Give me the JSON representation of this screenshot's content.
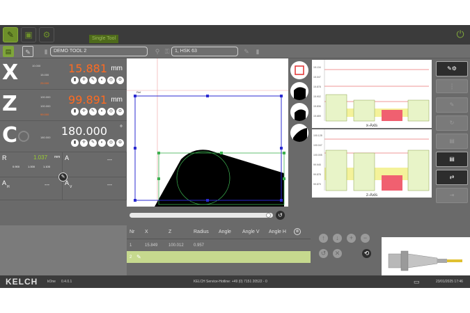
{
  "topbar": {
    "tooltip": "Single Tool"
  },
  "toolrow": {
    "tool_name": "DEMO TOOL 2",
    "holder": "1, HSK 63"
  },
  "axes": [
    {
      "letter": "X",
      "value": "15.881",
      "unit": "mm",
      "color": "#ff6a20",
      "mini": [
        "10.000",
        "15.000",
        "25.000"
      ]
    },
    {
      "letter": "Z",
      "value": "99.891",
      "unit": "mm",
      "color": "#ff6a20",
      "mini": [
        "100.000",
        "100.000",
        "99.000"
      ]
    },
    {
      "letter": "C",
      "value": "180.000",
      "unit": "°",
      "color": "#ffffff",
      "mini": [
        "",
        "180.000",
        ""
      ]
    }
  ],
  "cells": {
    "r_label": "R",
    "r_value": "1.037",
    "r_unit": "mm",
    "r_small": [
      "0.900",
      "1.000",
      "1.100"
    ],
    "a_label": "A",
    "a_value": "---",
    "ah_label": "A",
    "ah_sub": "H",
    "ah_value": "---",
    "av_label": "A",
    "av_sub": "V",
    "av_value": "---"
  },
  "canvas": {
    "corner_label": "Ref"
  },
  "charts": {
    "x_title": "x-Axis",
    "z_title": "z-Axis",
    "x_ticks": [
      "15.134",
      "15.047",
      "15.878",
      "15.902",
      "15.836",
      "15.689"
    ],
    "z_ticks": [
      "100.128",
      "100.047",
      "100.005",
      "99.945",
      "99.878",
      "99.879"
    ]
  },
  "right_buttons": [
    "",
    "",
    "",
    "",
    "",
    "",
    "",
    ""
  ],
  "table": {
    "headers": [
      "Nr",
      "X",
      "Z",
      "Radius",
      "Angle",
      "Angle V",
      "Angle H"
    ],
    "rows": [
      {
        "nr": "1",
        "x": "15.849",
        "z": "100.012",
        "r": "0.957"
      },
      {
        "nr": "2",
        "x": "",
        "z": "",
        "r": ""
      }
    ]
  },
  "footer": {
    "logo": "KELCH",
    "app": "kOne",
    "version": "0.4.0.1",
    "hotline": "KELCH Service-Hotline: +49 (0) 7151 20522 - 0",
    "datetime": "23/01/2025 17:46"
  },
  "colors": {
    "accent": "#6d8f2a",
    "orange": "#ff6a20",
    "blue": "#2a2ad0",
    "green": "#3cb050"
  }
}
